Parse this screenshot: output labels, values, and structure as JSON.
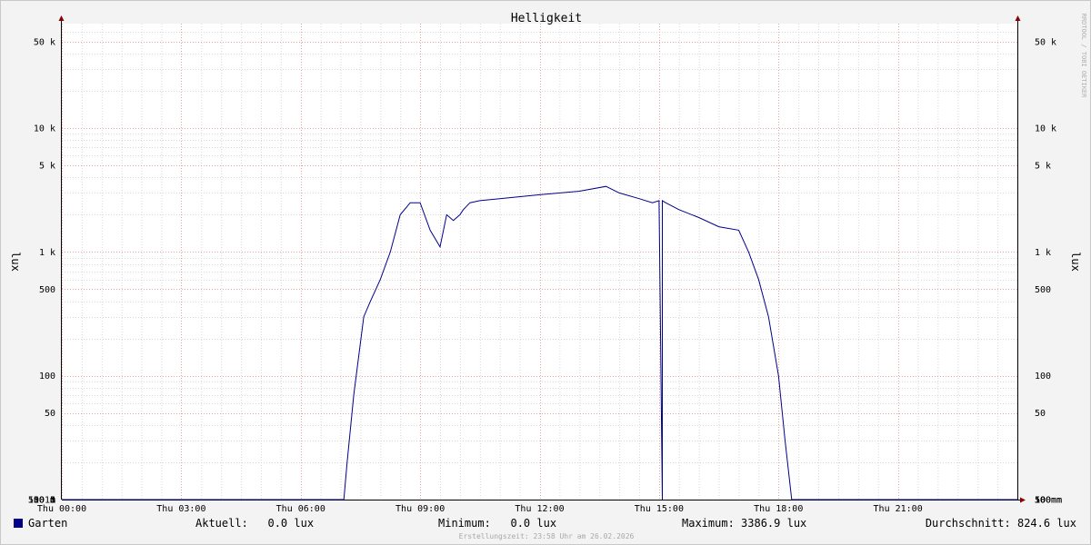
{
  "chart_data": {
    "type": "line",
    "title": "Helligkeit",
    "ylabel": "lux",
    "ylabel_right": "lux",
    "yscale": "log",
    "ylim": [
      10,
      70000
    ],
    "xlim": [
      "Thu 00:00",
      "Thu 24:00"
    ],
    "x_ticks": [
      "Thu 00:00",
      "Thu 03:00",
      "Thu 06:00",
      "Thu 09:00",
      "Thu 12:00",
      "Thu 15:00",
      "Thu 18:00",
      "Thu 21:00"
    ],
    "y_ticks": [
      {
        "value": 50000,
        "label": "50 k"
      },
      {
        "value": 10000,
        "label": "10 k"
      },
      {
        "value": 5000,
        "label": "5 k"
      },
      {
        "value": 1000,
        "label": "1 k"
      },
      {
        "value": 500,
        "label": "500"
      },
      {
        "value": 100,
        "label": "100"
      },
      {
        "value": 50,
        "label": "50"
      },
      {
        "value": 10,
        "label": "10"
      },
      {
        "value": 5,
        "label": "5"
      },
      {
        "value": 1,
        "label": "1"
      },
      {
        "value": 0.5,
        "label": "500 m"
      },
      {
        "value": 0.1,
        "label": "100 m"
      },
      {
        "value": 0.05,
        "label": "50 m"
      },
      {
        "value": 0.01,
        "label": "10 m"
      }
    ],
    "grid": true,
    "series": [
      {
        "name": "Garten",
        "color": "#00008b",
        "x": [
          "00:00",
          "06:40",
          "06:40",
          "06:50",
          "06:55",
          "07:05",
          "07:10",
          "07:20",
          "07:35",
          "07:45",
          "08:00",
          "08:15",
          "08:30",
          "08:45",
          "09:00",
          "09:15",
          "09:30",
          "09:40",
          "09:50",
          "10:00",
          "10:05",
          "10:15",
          "10:30",
          "11:00",
          "12:00",
          "13:00",
          "13:40",
          "14:00",
          "14:30",
          "14:50",
          "15:00",
          "15:05",
          "15:05",
          "15:10",
          "15:30",
          "16:00",
          "16:30",
          "17:00",
          "17:15",
          "17:30",
          "17:45",
          "18:00",
          "18:10",
          "18:20",
          "18:30",
          "18:40",
          "18:45",
          "18:50",
          "19:00",
          "19:10",
          "19:20",
          "19:20",
          "19:30",
          "19:30",
          "19:40",
          "19:45",
          "19:45",
          "19:50",
          "19:50",
          "20:40",
          "20:40",
          "21:20",
          "21:20",
          "22:20",
          "22:20",
          "22:40",
          "22:40",
          "24:00"
        ],
        "y": [
          0.01,
          0.01,
          0.05,
          0.2,
          1,
          5,
          20,
          70,
          300,
          400,
          600,
          1000,
          2000,
          2500,
          2500,
          1500,
          1100,
          2000,
          1800,
          2000,
          2200,
          2500,
          2600,
          2700,
          2900,
          3100,
          3387,
          3000,
          2700,
          2500,
          2600,
          0.03,
          2600,
          2500,
          2200,
          1900,
          1600,
          1500,
          1000,
          600,
          300,
          100,
          30,
          5,
          0.5,
          0.1,
          0.05,
          0.05,
          0.05,
          0.05,
          0.05,
          0.2,
          0.2,
          0.05,
          0.05,
          0.05,
          0.01,
          0.05,
          0.01,
          0.01,
          0.05,
          0.05,
          0.01,
          0.01,
          0.05,
          0.05,
          0.01,
          0.01
        ]
      }
    ]
  },
  "watermark": "RRDTOOL / TOBI OETIKER",
  "legend": {
    "swatch_color": "#00008b",
    "name": "Garten",
    "aktuell": "Aktuell:   0.0 lux",
    "minimum": "Minimum:   0.0 lux",
    "maximum": "Maximum: 3386.9 lux",
    "durchschnitt": "Durchschnitt: 824.6 lux"
  },
  "created": "Erstellungszeit: 23:58 Uhr am 26.02.2026",
  "colors": {
    "background": "#f3f3f3",
    "plot": "#ffffff",
    "major_grid": "#e8a0a0",
    "minor_grid": "#d8d8d8",
    "axis": "#000000",
    "arrow": "#8b0000"
  }
}
